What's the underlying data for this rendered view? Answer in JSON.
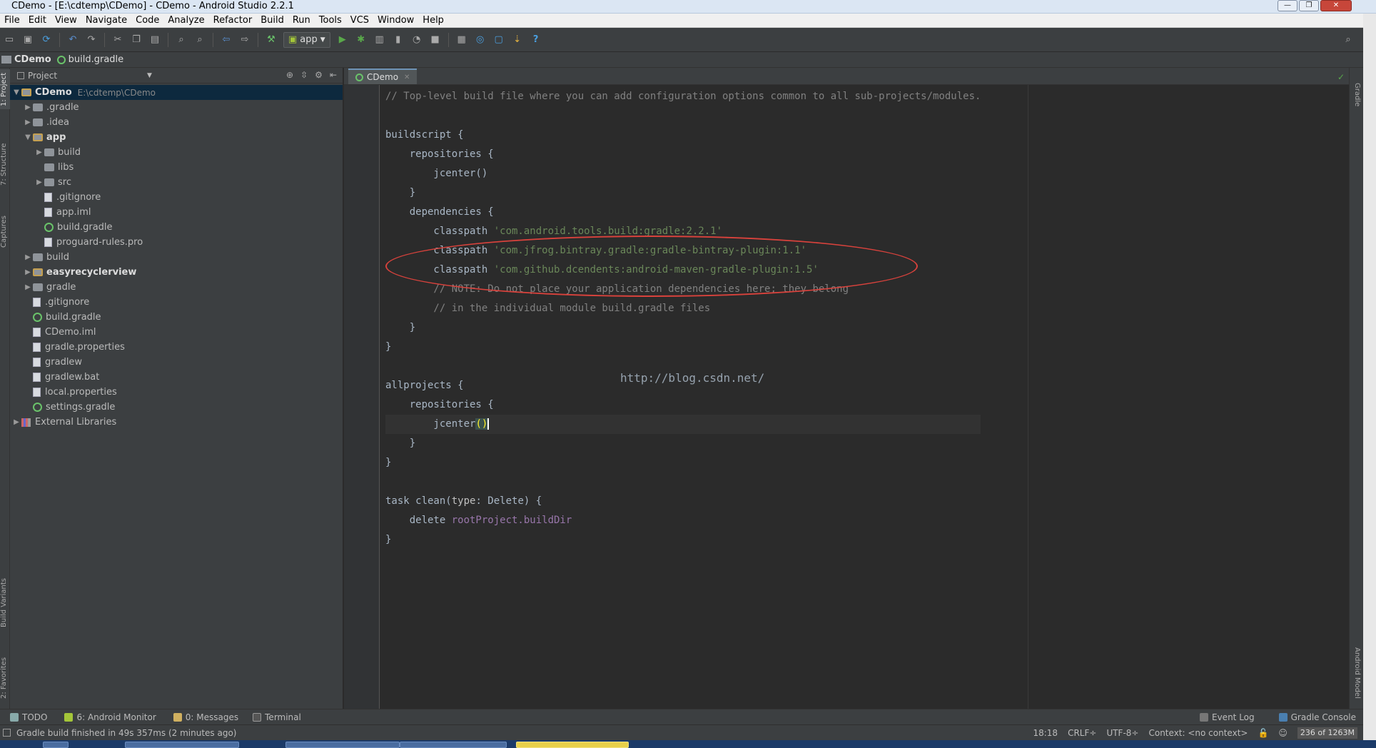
{
  "window": {
    "title": "CDemo - [E:\\cdtemp\\CDemo] - CDemo - Android Studio 2.2.1",
    "min": "—",
    "max": "❐",
    "close": "✕"
  },
  "menu": [
    "File",
    "Edit",
    "View",
    "Navigate",
    "Code",
    "Analyze",
    "Refactor",
    "Build",
    "Run",
    "Tools",
    "VCS",
    "Window",
    "Help"
  ],
  "toolbar": {
    "run_config": "app",
    "help": "?"
  },
  "navbar": {
    "project": "CDemo",
    "file": "build.gradle"
  },
  "left_tabs": {
    "project": "1: Project",
    "structure": "7: Structure",
    "captures": "Captures",
    "build_variants": "Build Variants",
    "favorites": "2: Favorites"
  },
  "project_panel": {
    "title": "Project"
  },
  "tree": [
    {
      "label": "CDemo",
      "path": "E:\\cdtemp\\CDemo",
      "depth": 0,
      "arrow": "▼",
      "type": "module",
      "bold": true,
      "sel": true
    },
    {
      "label": ".gradle",
      "depth": 1,
      "arrow": "▶",
      "type": "folder"
    },
    {
      "label": ".idea",
      "depth": 1,
      "arrow": "▶",
      "type": "folder"
    },
    {
      "label": "app",
      "depth": 1,
      "arrow": "▼",
      "type": "module",
      "bold": true
    },
    {
      "label": "build",
      "depth": 2,
      "arrow": "▶",
      "type": "folder"
    },
    {
      "label": "libs",
      "depth": 2,
      "arrow": "",
      "type": "folder"
    },
    {
      "label": "src",
      "depth": 2,
      "arrow": "▶",
      "type": "folder"
    },
    {
      "label": ".gitignore",
      "depth": 2,
      "arrow": "",
      "type": "file"
    },
    {
      "label": "app.iml",
      "depth": 2,
      "arrow": "",
      "type": "file"
    },
    {
      "label": "build.gradle",
      "depth": 2,
      "arrow": "",
      "type": "gradle"
    },
    {
      "label": "proguard-rules.pro",
      "depth": 2,
      "arrow": "",
      "type": "file"
    },
    {
      "label": "build",
      "depth": 1,
      "arrow": "▶",
      "type": "folder"
    },
    {
      "label": "easyrecyclerview",
      "depth": 1,
      "arrow": "▶",
      "type": "module",
      "bold": true
    },
    {
      "label": "gradle",
      "depth": 1,
      "arrow": "▶",
      "type": "folder"
    },
    {
      "label": ".gitignore",
      "depth": 1,
      "arrow": "",
      "type": "file"
    },
    {
      "label": "build.gradle",
      "depth": 1,
      "arrow": "",
      "type": "gradle"
    },
    {
      "label": "CDemo.iml",
      "depth": 1,
      "arrow": "",
      "type": "file"
    },
    {
      "label": "gradle.properties",
      "depth": 1,
      "arrow": "",
      "type": "file"
    },
    {
      "label": "gradlew",
      "depth": 1,
      "arrow": "",
      "type": "file"
    },
    {
      "label": "gradlew.bat",
      "depth": 1,
      "arrow": "",
      "type": "file"
    },
    {
      "label": "local.properties",
      "depth": 1,
      "arrow": "",
      "type": "file"
    },
    {
      "label": "settings.gradle",
      "depth": 1,
      "arrow": "",
      "type": "gradle"
    },
    {
      "label": "External Libraries",
      "depth": 0,
      "arrow": "▶",
      "type": "lib"
    }
  ],
  "editor": {
    "tab": "CDemo",
    "watermark": "http://blog.csdn.net/",
    "lines": [
      [
        {
          "t": "// Top-level build file where you can add configuration options common to all sub-projects/modules.",
          "c": "cmt"
        }
      ],
      [],
      [
        {
          "t": "buildscript {"
        }
      ],
      [
        {
          "t": "    repositories {"
        }
      ],
      [
        {
          "t": "        jcenter()"
        }
      ],
      [
        {
          "t": "    }"
        }
      ],
      [
        {
          "t": "    dependencies {"
        }
      ],
      [
        {
          "t": "        classpath "
        },
        {
          "t": "'com.android.tools.build:gradle:2.2.1'",
          "c": "str"
        }
      ],
      [
        {
          "t": "        classpath "
        },
        {
          "t": "'com.jfrog.bintray.gradle:gradle-bintray-plugin:1.1'",
          "c": "str"
        }
      ],
      [
        {
          "t": "        classpath "
        },
        {
          "t": "'com.github.dcendents:android-maven-gradle-plugin:1.5'",
          "c": "str"
        }
      ],
      [
        {
          "t": "        // NOTE: Do not place your application dependencies here; they belong",
          "c": "cmt"
        }
      ],
      [
        {
          "t": "        // in the individual module build.gradle files",
          "c": "cmt"
        }
      ],
      [
        {
          "t": "    }"
        }
      ],
      [
        {
          "t": "}"
        }
      ],
      [],
      [
        {
          "t": "allprojects {"
        }
      ],
      [
        {
          "t": "    repositories {"
        }
      ],
      [
        {
          "t": "        jcenter"
        },
        {
          "t": "()",
          "c": "hl"
        },
        {
          "t": "",
          "c": "caret"
        }
      ],
      [
        {
          "t": "    }"
        }
      ],
      [
        {
          "t": "}"
        }
      ],
      [],
      [
        {
          "t": "task clean("
        },
        {
          "t": "type",
          "c": "par"
        },
        {
          "t": ": Delete) {"
        }
      ],
      [
        {
          "t": "    delete "
        },
        {
          "t": "rootProject.buildDir",
          "c": "fld"
        }
      ],
      [
        {
          "t": "}"
        }
      ]
    ]
  },
  "right_tabs": {
    "gradle": "Gradle",
    "android_model": "Android Model"
  },
  "bottom_tools": {
    "todo": "TODO",
    "monitor": "6: Android Monitor",
    "messages": "0: Messages",
    "terminal": "Terminal",
    "event_log": "Event Log",
    "gradle_console": "Gradle Console"
  },
  "status": {
    "message": "Gradle build finished in 49s 357ms (2 minutes ago)",
    "position": "18:18",
    "line_sep": "CRLF÷",
    "encoding": "UTF-8÷",
    "context": "Context: <no context>",
    "memory": "236 of 1263M"
  },
  "colors": {
    "ellipse": "#d9423c",
    "editor_bg": "#2b2b2b",
    "panel_bg": "#3c3f41"
  }
}
